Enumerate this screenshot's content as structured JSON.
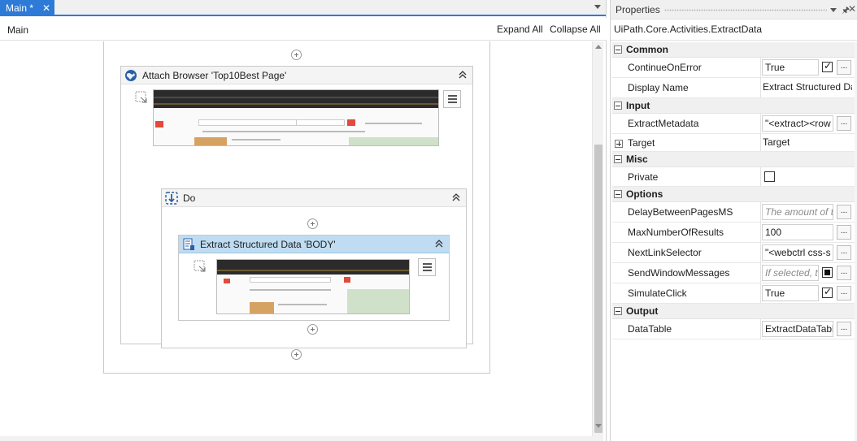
{
  "tab": {
    "label": "Main *",
    "close": "✕"
  },
  "breadcrumb": "Main",
  "toolbar": {
    "expand_all": "Expand All",
    "collapse_all": "Collapse All"
  },
  "workflow": {
    "attach_title": "Attach Browser 'Top10Best Page'",
    "do_title": "Do",
    "extract_title": "Extract Structured Data 'BODY'"
  },
  "properties": {
    "title": "Properties",
    "pin": "🖈",
    "close": "✕",
    "type_name": "UiPath.Core.Activities.ExtractData",
    "categories": {
      "common": "Common",
      "input": "Input",
      "misc": "Misc",
      "options": "Options",
      "output": "Output"
    },
    "rows": {
      "continue_on_error": {
        "name": "ContinueOnError",
        "value": "True"
      },
      "display_name": {
        "name": "Display Name",
        "value": "Extract Structured Data 'BODY'"
      },
      "extract_metadata": {
        "name": "ExtractMetadata",
        "value": "\"<extract><row"
      },
      "target": {
        "name": "Target",
        "value": "Target"
      },
      "private": {
        "name": "Private"
      },
      "delay_between_pages": {
        "name": "DelayBetweenPagesMS",
        "placeholder": "The amount of time"
      },
      "max_results": {
        "name": "MaxNumberOfResults",
        "value": "100"
      },
      "next_link_selector": {
        "name": "NextLinkSelector",
        "value": "\"<webctrl css-s"
      },
      "send_window_messages": {
        "name": "SendWindowMessages",
        "placeholder": "If selected, t"
      },
      "simulate_click": {
        "name": "SimulateClick",
        "value": "True"
      },
      "data_table": {
        "name": "DataTable",
        "value": "ExtractDataTable"
      }
    },
    "ellipsis": "...",
    "colors": {
      "accent": "#2d7bd6",
      "selected_header": "#bfdcf2"
    }
  }
}
